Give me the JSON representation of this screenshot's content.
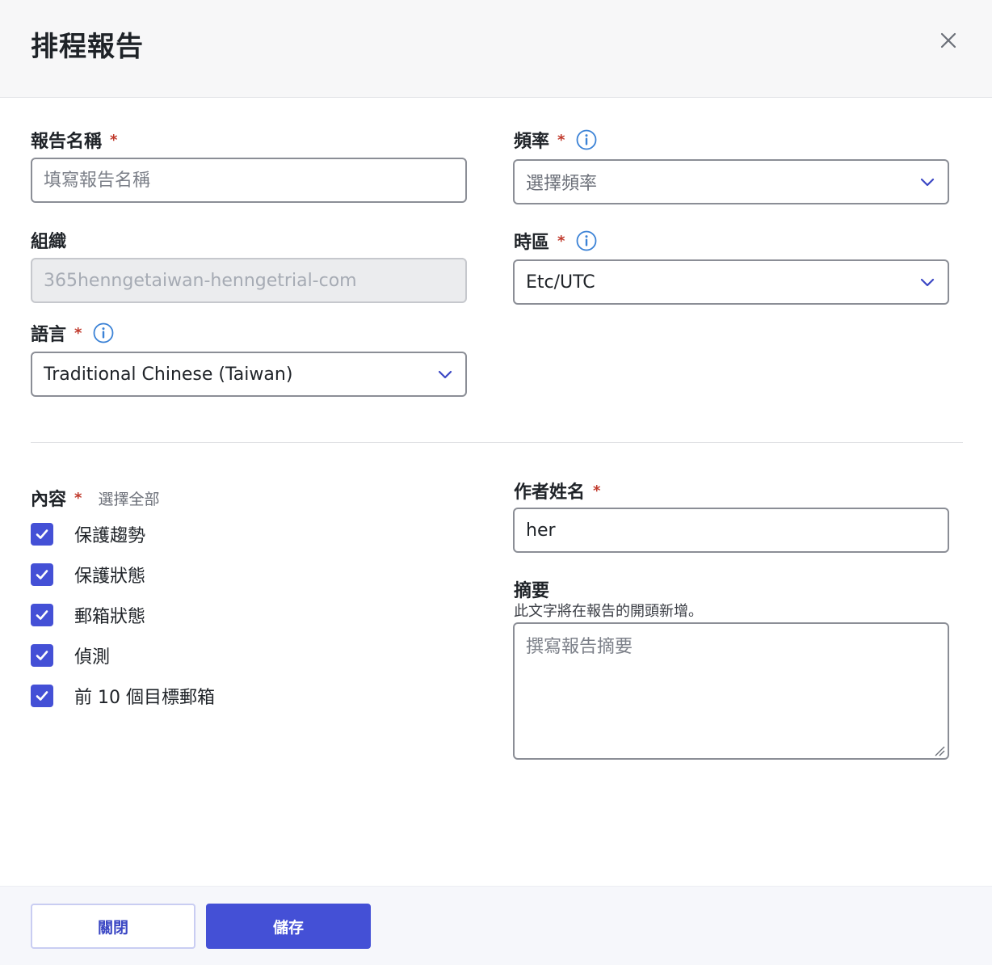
{
  "dialog": {
    "title": "排程報告"
  },
  "form": {
    "report_name": {
      "label": "報告名稱",
      "required_mark": "*",
      "placeholder": "填寫報告名稱",
      "value": ""
    },
    "organization": {
      "label": "組織",
      "value": "365henngetaiwan-henngetrial-com"
    },
    "language": {
      "label": "語言",
      "required_mark": "*",
      "value": "Traditional Chinese (Taiwan)"
    },
    "frequency": {
      "label": "頻率",
      "required_mark": "*",
      "placeholder": "選擇頻率"
    },
    "timezone": {
      "label": "時區",
      "required_mark": "*",
      "value": "Etc/UTC"
    },
    "content": {
      "label": "內容",
      "required_mark": "*",
      "select_all": "選擇全部",
      "items": [
        {
          "label": "保護趨勢",
          "checked": true
        },
        {
          "label": "保護狀態",
          "checked": true
        },
        {
          "label": "郵箱狀態",
          "checked": true
        },
        {
          "label": "偵測",
          "checked": true
        },
        {
          "label": "前 10 個目標郵箱",
          "checked": true
        }
      ]
    },
    "author": {
      "label": "作者姓名",
      "required_mark": "*",
      "value": "her"
    },
    "summary": {
      "label": "摘要",
      "helper": "此文字將在報告的開頭新增。",
      "placeholder": "撰寫報告摘要"
    }
  },
  "footer": {
    "close_label": "關閉",
    "save_label": "儲存"
  },
  "colors": {
    "accent": "#4450d6",
    "required": "#c0392b",
    "info": "#3b82d6"
  },
  "icons": [
    "close-icon",
    "info-icon",
    "chevron-down-icon",
    "checkmark-icon"
  ]
}
